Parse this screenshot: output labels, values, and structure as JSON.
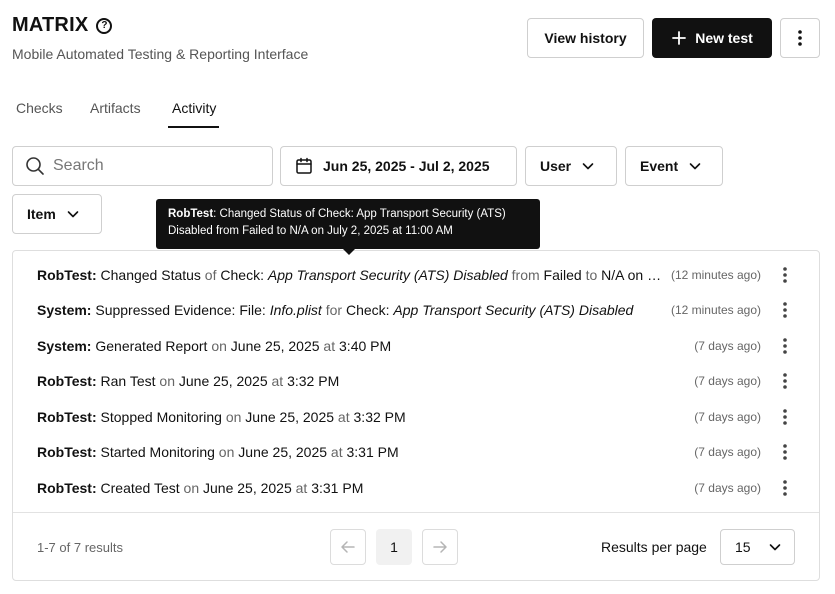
{
  "header": {
    "title": "MATRIX",
    "subtitle": "Mobile Automated Testing & Reporting Interface",
    "view_history_label": "View history",
    "new_test_label": "New test"
  },
  "tabs": [
    {
      "label": "Checks",
      "active": false
    },
    {
      "label": "Artifacts",
      "active": false
    },
    {
      "label": "Activity",
      "active": true
    }
  ],
  "filters": {
    "search_placeholder": "Search",
    "search_value": "",
    "date_range": "Jun 25, 2025 - Jul 2, 2025",
    "user_label": "User",
    "event_label": "Event",
    "item_label": "Item"
  },
  "tooltip": {
    "actor": "RobTest",
    "text": ": Changed Status of Check: App Transport Security (ATS) Disabled from Failed to N/A on July 2, 2025 at 11:00 AM"
  },
  "activity": [
    {
      "actor": "RobTest:",
      "parts": [
        {
          "t": " Changed Status",
          "s": "n"
        },
        {
          "t": " of ",
          "s": "m"
        },
        {
          "t": "Check: ",
          "s": "n"
        },
        {
          "t": "App Transport Security (ATS) Disabled",
          "s": "i"
        },
        {
          "t": " from ",
          "s": "m"
        },
        {
          "t": "Failed",
          "s": "n"
        },
        {
          "t": " to ",
          "s": "m"
        },
        {
          "t": "N/A on July 2, 2025 at 11:00 AM",
          "s": "n"
        }
      ],
      "time": "(12 minutes ago)"
    },
    {
      "actor": "System:",
      "parts": [
        {
          "t": " Suppressed Evidence: File: ",
          "s": "n"
        },
        {
          "t": "Info.plist",
          "s": "i"
        },
        {
          "t": " for ",
          "s": "m"
        },
        {
          "t": "Check: ",
          "s": "n"
        },
        {
          "t": "App Transport Security (ATS) Disabled",
          "s": "i"
        }
      ],
      "time": "(12 minutes ago)"
    },
    {
      "actor": "System:",
      "parts": [
        {
          "t": " Generated Report",
          "s": "n"
        },
        {
          "t": " on ",
          "s": "m"
        },
        {
          "t": "June 25, 2025",
          "s": "n"
        },
        {
          "t": " at ",
          "s": "m"
        },
        {
          "t": "3:40 PM",
          "s": "n"
        }
      ],
      "time": "(7 days ago)"
    },
    {
      "actor": "RobTest:",
      "parts": [
        {
          "t": " Ran Test",
          "s": "n"
        },
        {
          "t": " on ",
          "s": "m"
        },
        {
          "t": "June 25, 2025",
          "s": "n"
        },
        {
          "t": " at ",
          "s": "m"
        },
        {
          "t": "3:32 PM",
          "s": "n"
        }
      ],
      "time": "(7 days ago)"
    },
    {
      "actor": "RobTest:",
      "parts": [
        {
          "t": " Stopped Monitoring",
          "s": "n"
        },
        {
          "t": " on ",
          "s": "m"
        },
        {
          "t": "June 25, 2025",
          "s": "n"
        },
        {
          "t": " at ",
          "s": "m"
        },
        {
          "t": "3:32 PM",
          "s": "n"
        }
      ],
      "time": "(7 days ago)"
    },
    {
      "actor": "RobTest:",
      "parts": [
        {
          "t": " Started Monitoring",
          "s": "n"
        },
        {
          "t": " on ",
          "s": "m"
        },
        {
          "t": "June 25, 2025",
          "s": "n"
        },
        {
          "t": " at ",
          "s": "m"
        },
        {
          "t": "3:31 PM",
          "s": "n"
        }
      ],
      "time": "(7 days ago)"
    },
    {
      "actor": "RobTest:",
      "parts": [
        {
          "t": " Created Test",
          "s": "n"
        },
        {
          "t": " on ",
          "s": "m"
        },
        {
          "t": "June 25, 2025",
          "s": "n"
        },
        {
          "t": " at ",
          "s": "m"
        },
        {
          "t": "3:31 PM",
          "s": "n"
        }
      ],
      "time": "(7 days ago)"
    }
  ],
  "pagination": {
    "summary": "1-7 of 7 results",
    "current_page": "1",
    "results_per_page_label": "Results per page",
    "results_per_page_value": "15"
  },
  "icons": {
    "help": "help-circle-icon",
    "plus": "plus-icon",
    "more": "more-vertical-icon",
    "search": "search-icon",
    "calendar": "calendar-icon",
    "chevron": "chevron-down-icon",
    "prev": "arrow-left-icon",
    "next": "arrow-right-icon"
  }
}
